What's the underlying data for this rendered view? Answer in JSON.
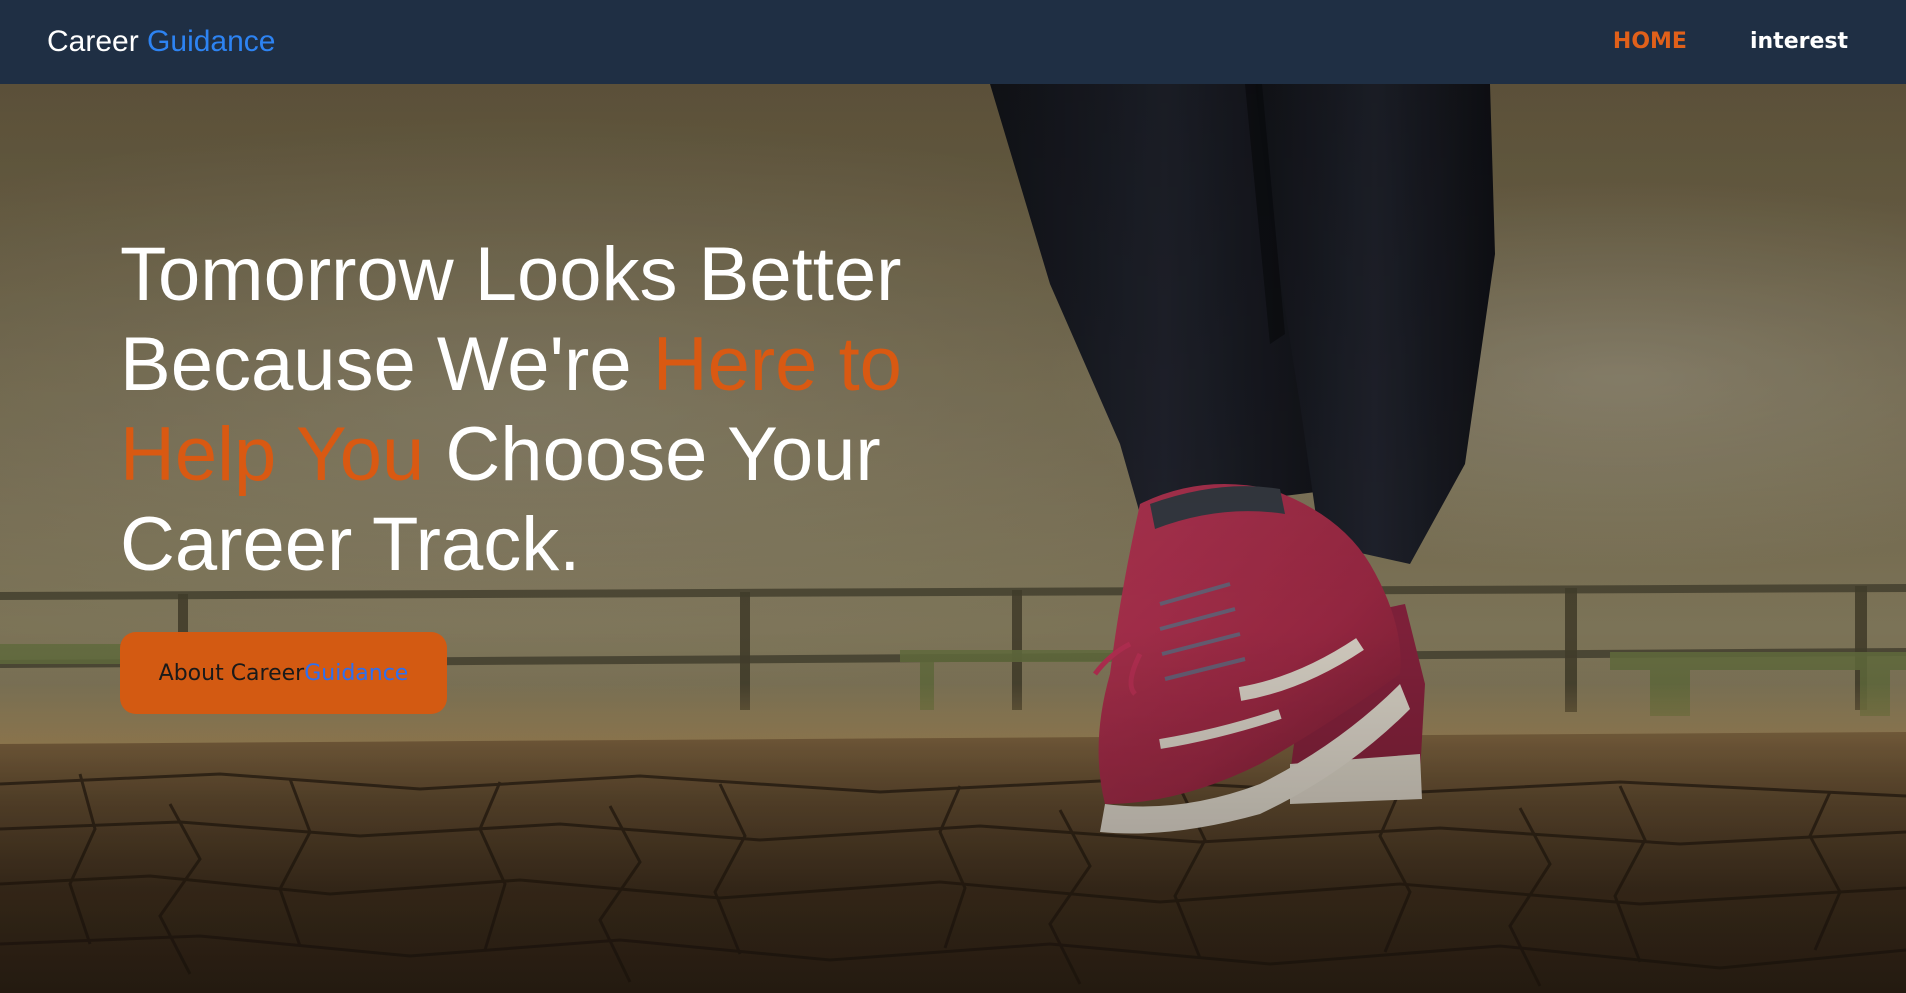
{
  "navbar": {
    "brand_part1": "Career",
    "brand_part2": "Guidance",
    "links": [
      {
        "label": "HOME",
        "active": true
      },
      {
        "label": "interest",
        "active": false
      }
    ]
  },
  "hero": {
    "headline_part1": "Tomorrow Looks Better Because We're ",
    "headline_highlight": "Here to Help You",
    "headline_part2": " Choose Your Career Track.",
    "cta_part1": "About Career ",
    "cta_part2": "Guidance",
    "background_image": "person-walking-in-red-sneakers-on-cobblestone-pier"
  },
  "colors": {
    "navbar_bg": "#1f2f44",
    "accent_orange": "#d95912",
    "accent_blue": "#2d83f2",
    "text_white": "#ffffff"
  }
}
